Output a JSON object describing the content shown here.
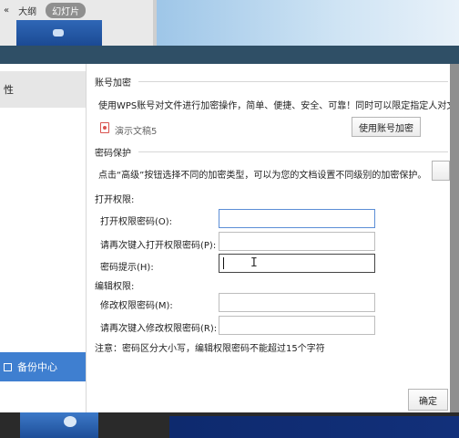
{
  "background": {
    "tabs": [
      {
        "label": "«"
      },
      {
        "label": "大纲"
      },
      {
        "label": "幻灯片"
      }
    ]
  },
  "dialog": {
    "title": "",
    "nav": {
      "properties": "性",
      "backup_center": "备份中心"
    },
    "account_encryption": {
      "heading": "账号加密",
      "description": "使用WPS账号对文件进行加密操作，简单、便捷、安全、可靠！同时可以限定指定人对文",
      "file_name": "演示文稿5",
      "button": "使用账号加密"
    },
    "password_protection": {
      "heading": "密码保护",
      "description": "点击“高级”按钮选择不同的加密类型，可以为您的文档设置不同级别的加密保护。",
      "open_permission": {
        "heading": "打开权限:",
        "open_password_label": "打开权限密码(O):",
        "confirm_open_password_label": "请再次键入打开权限密码(P):",
        "hint_label": "密码提示(H):",
        "open_password_value": "",
        "confirm_open_password_value": "",
        "hint_value": ""
      },
      "edit_permission": {
        "heading": "编辑权限:",
        "edit_password_label": "修改权限密码(M):",
        "confirm_edit_password_label": "请再次键入修改权限密码(R):",
        "edit_password_value": "",
        "confirm_edit_password_value": ""
      },
      "note": "注意：密码区分大小写，编辑权限密码不能超过15个字符"
    },
    "ok_button": "确定"
  },
  "colors": {
    "titlebar": "#2f4f66",
    "accent": "#3f7fd0",
    "focus_border": "#5c8ed6"
  }
}
